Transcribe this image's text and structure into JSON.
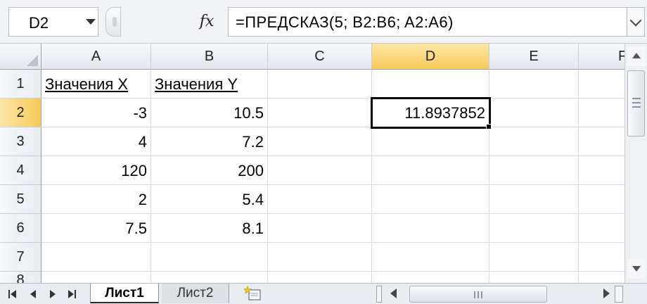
{
  "formula_bar": {
    "name_box": "D2",
    "fx_label": "fx",
    "formula": "=ПРЕДСКАЗ(5; B2:B6; A2:A6)"
  },
  "columns": [
    "A",
    "B",
    "C",
    "D",
    "E",
    "F"
  ],
  "selected_column": "D",
  "rows": [
    "1",
    "2",
    "3",
    "4",
    "5",
    "6",
    "7",
    "8"
  ],
  "selected_row": "2",
  "cells": {
    "A1": "Значения X",
    "B1": "Значения Y",
    "A2": "-3",
    "B2": "10.5",
    "D2": "11.8937852",
    "A3": "4",
    "B3": "7.2",
    "A4": "120",
    "B4": "200",
    "A5": "2",
    "B5": "5.4",
    "A6": "7.5",
    "B6": "8.1"
  },
  "active_cell": "D2",
  "sheet_tabs": [
    {
      "label": "Лист1",
      "active": true
    },
    {
      "label": "Лист2",
      "active": false
    }
  ],
  "icons": {
    "name_box_dropdown": "chevron-down-icon",
    "formula_expand": "chevron-down-icon",
    "insert_sheet": "insert-sheet-icon",
    "nav_first": "first-sheet-icon",
    "nav_prev": "prev-sheet-icon",
    "nav_next": "next-sheet-icon",
    "nav_last": "last-sheet-icon"
  },
  "colors": {
    "selected_header": "#f7c95c",
    "active_border": "#000000"
  }
}
